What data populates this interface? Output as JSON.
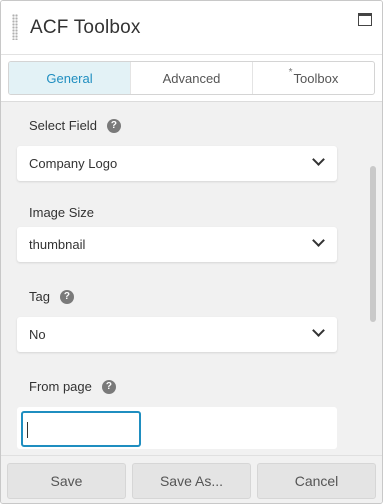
{
  "header": {
    "title": "ACF Toolbox"
  },
  "tabs": [
    {
      "label": "General",
      "active": true,
      "marker": ""
    },
    {
      "label": "Advanced",
      "active": false,
      "marker": ""
    },
    {
      "label": "Toolbox",
      "active": false,
      "marker": "*"
    }
  ],
  "fields": {
    "select_field": {
      "label": "Select Field",
      "value": "Company Logo",
      "help": "?"
    },
    "image_size": {
      "label": "Image Size",
      "value": "thumbnail"
    },
    "tag": {
      "label": "Tag",
      "value": "No",
      "help": "?"
    },
    "from_page": {
      "label": "From page",
      "value": "",
      "help": "?"
    }
  },
  "footer": {
    "save": "Save",
    "save_as": "Save As...",
    "cancel": "Cancel"
  },
  "colors": {
    "accent": "#1f8ec0",
    "active_tab_bg": "#e3f2f6"
  },
  "icons": {
    "drag": "drag-handle-icon",
    "maximize": "maximize-icon",
    "help": "help-icon",
    "dropdown": "chevron-down-icon"
  }
}
